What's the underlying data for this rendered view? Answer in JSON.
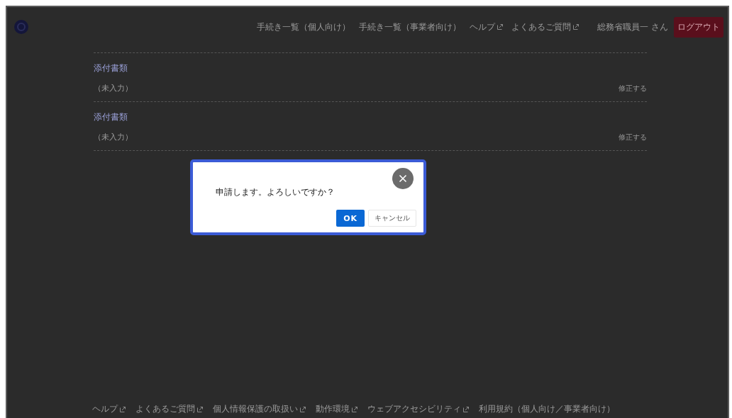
{
  "header": {
    "nav": [
      {
        "label": "手続き一覧（個人向け）",
        "external": false
      },
      {
        "label": "手続き一覧（事業者向け）",
        "external": false
      },
      {
        "label": "ヘルプ",
        "external": true
      },
      {
        "label": "よくあるご質問",
        "external": true
      }
    ],
    "user": "総務省職員一 さん",
    "logout": "ログアウト"
  },
  "sections": [
    {
      "title": "添付書類",
      "value": "（未入力）",
      "action": "修正する"
    },
    {
      "title": "添付書類",
      "value": "（未入力）",
      "action": "修正する"
    }
  ],
  "dialog": {
    "message": "申請します。よろしいですか？",
    "buttons": [
      {
        "label": "OK",
        "kind": "primary"
      },
      {
        "label": "キャンセル",
        "kind": "secondary"
      }
    ]
  },
  "footer": [
    {
      "label": "ヘルプ",
      "external": true
    },
    {
      "label": "よくあるご質問",
      "external": true
    },
    {
      "label": "個人情報保護の取扱い",
      "external": true
    },
    {
      "label": "動作環境",
      "external": true
    },
    {
      "label": "ウェブアクセシビリティ",
      "external": true
    },
    {
      "label": "利用規約（個人向け／事業者向け）",
      "external": false
    }
  ]
}
